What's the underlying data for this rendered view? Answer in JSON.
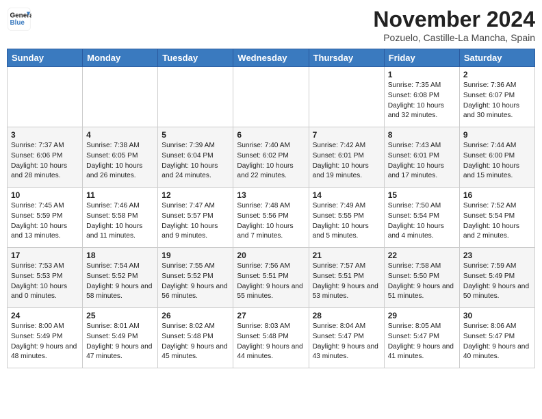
{
  "header": {
    "logo_line1": "General",
    "logo_line2": "Blue",
    "month": "November 2024",
    "location": "Pozuelo, Castille-La Mancha, Spain"
  },
  "days_of_week": [
    "Sunday",
    "Monday",
    "Tuesday",
    "Wednesday",
    "Thursday",
    "Friday",
    "Saturday"
  ],
  "weeks": [
    [
      {
        "day": "",
        "info": ""
      },
      {
        "day": "",
        "info": ""
      },
      {
        "day": "",
        "info": ""
      },
      {
        "day": "",
        "info": ""
      },
      {
        "day": "",
        "info": ""
      },
      {
        "day": "1",
        "info": "Sunrise: 7:35 AM\nSunset: 6:08 PM\nDaylight: 10 hours and 32 minutes."
      },
      {
        "day": "2",
        "info": "Sunrise: 7:36 AM\nSunset: 6:07 PM\nDaylight: 10 hours and 30 minutes."
      }
    ],
    [
      {
        "day": "3",
        "info": "Sunrise: 7:37 AM\nSunset: 6:06 PM\nDaylight: 10 hours and 28 minutes."
      },
      {
        "day": "4",
        "info": "Sunrise: 7:38 AM\nSunset: 6:05 PM\nDaylight: 10 hours and 26 minutes."
      },
      {
        "day": "5",
        "info": "Sunrise: 7:39 AM\nSunset: 6:04 PM\nDaylight: 10 hours and 24 minutes."
      },
      {
        "day": "6",
        "info": "Sunrise: 7:40 AM\nSunset: 6:02 PM\nDaylight: 10 hours and 22 minutes."
      },
      {
        "day": "7",
        "info": "Sunrise: 7:42 AM\nSunset: 6:01 PM\nDaylight: 10 hours and 19 minutes."
      },
      {
        "day": "8",
        "info": "Sunrise: 7:43 AM\nSunset: 6:01 PM\nDaylight: 10 hours and 17 minutes."
      },
      {
        "day": "9",
        "info": "Sunrise: 7:44 AM\nSunset: 6:00 PM\nDaylight: 10 hours and 15 minutes."
      }
    ],
    [
      {
        "day": "10",
        "info": "Sunrise: 7:45 AM\nSunset: 5:59 PM\nDaylight: 10 hours and 13 minutes."
      },
      {
        "day": "11",
        "info": "Sunrise: 7:46 AM\nSunset: 5:58 PM\nDaylight: 10 hours and 11 minutes."
      },
      {
        "day": "12",
        "info": "Sunrise: 7:47 AM\nSunset: 5:57 PM\nDaylight: 10 hours and 9 minutes."
      },
      {
        "day": "13",
        "info": "Sunrise: 7:48 AM\nSunset: 5:56 PM\nDaylight: 10 hours and 7 minutes."
      },
      {
        "day": "14",
        "info": "Sunrise: 7:49 AM\nSunset: 5:55 PM\nDaylight: 10 hours and 5 minutes."
      },
      {
        "day": "15",
        "info": "Sunrise: 7:50 AM\nSunset: 5:54 PM\nDaylight: 10 hours and 4 minutes."
      },
      {
        "day": "16",
        "info": "Sunrise: 7:52 AM\nSunset: 5:54 PM\nDaylight: 10 hours and 2 minutes."
      }
    ],
    [
      {
        "day": "17",
        "info": "Sunrise: 7:53 AM\nSunset: 5:53 PM\nDaylight: 10 hours and 0 minutes."
      },
      {
        "day": "18",
        "info": "Sunrise: 7:54 AM\nSunset: 5:52 PM\nDaylight: 9 hours and 58 minutes."
      },
      {
        "day": "19",
        "info": "Sunrise: 7:55 AM\nSunset: 5:52 PM\nDaylight: 9 hours and 56 minutes."
      },
      {
        "day": "20",
        "info": "Sunrise: 7:56 AM\nSunset: 5:51 PM\nDaylight: 9 hours and 55 minutes."
      },
      {
        "day": "21",
        "info": "Sunrise: 7:57 AM\nSunset: 5:51 PM\nDaylight: 9 hours and 53 minutes."
      },
      {
        "day": "22",
        "info": "Sunrise: 7:58 AM\nSunset: 5:50 PM\nDaylight: 9 hours and 51 minutes."
      },
      {
        "day": "23",
        "info": "Sunrise: 7:59 AM\nSunset: 5:49 PM\nDaylight: 9 hours and 50 minutes."
      }
    ],
    [
      {
        "day": "24",
        "info": "Sunrise: 8:00 AM\nSunset: 5:49 PM\nDaylight: 9 hours and 48 minutes."
      },
      {
        "day": "25",
        "info": "Sunrise: 8:01 AM\nSunset: 5:49 PM\nDaylight: 9 hours and 47 minutes."
      },
      {
        "day": "26",
        "info": "Sunrise: 8:02 AM\nSunset: 5:48 PM\nDaylight: 9 hours and 45 minutes."
      },
      {
        "day": "27",
        "info": "Sunrise: 8:03 AM\nSunset: 5:48 PM\nDaylight: 9 hours and 44 minutes."
      },
      {
        "day": "28",
        "info": "Sunrise: 8:04 AM\nSunset: 5:47 PM\nDaylight: 9 hours and 43 minutes."
      },
      {
        "day": "29",
        "info": "Sunrise: 8:05 AM\nSunset: 5:47 PM\nDaylight: 9 hours and 41 minutes."
      },
      {
        "day": "30",
        "info": "Sunrise: 8:06 AM\nSunset: 5:47 PM\nDaylight: 9 hours and 40 minutes."
      }
    ]
  ]
}
